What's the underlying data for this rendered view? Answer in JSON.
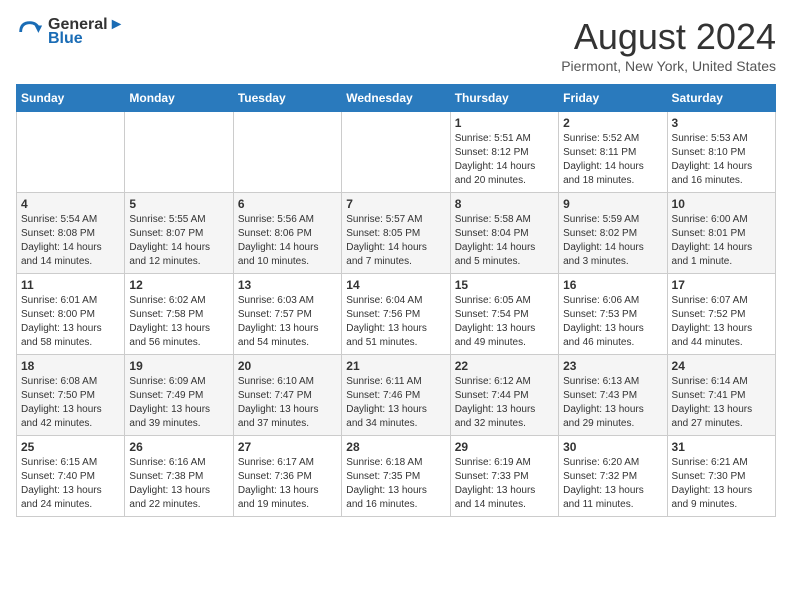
{
  "header": {
    "logo_line1": "General",
    "logo_line2": "Blue",
    "month": "August 2024",
    "location": "Piermont, New York, United States"
  },
  "weekdays": [
    "Sunday",
    "Monday",
    "Tuesday",
    "Wednesday",
    "Thursday",
    "Friday",
    "Saturday"
  ],
  "weeks": [
    [
      {
        "day": "",
        "info": ""
      },
      {
        "day": "",
        "info": ""
      },
      {
        "day": "",
        "info": ""
      },
      {
        "day": "",
        "info": ""
      },
      {
        "day": "1",
        "info": "Sunrise: 5:51 AM\nSunset: 8:12 PM\nDaylight: 14 hours\nand 20 minutes."
      },
      {
        "day": "2",
        "info": "Sunrise: 5:52 AM\nSunset: 8:11 PM\nDaylight: 14 hours\nand 18 minutes."
      },
      {
        "day": "3",
        "info": "Sunrise: 5:53 AM\nSunset: 8:10 PM\nDaylight: 14 hours\nand 16 minutes."
      }
    ],
    [
      {
        "day": "4",
        "info": "Sunrise: 5:54 AM\nSunset: 8:08 PM\nDaylight: 14 hours\nand 14 minutes."
      },
      {
        "day": "5",
        "info": "Sunrise: 5:55 AM\nSunset: 8:07 PM\nDaylight: 14 hours\nand 12 minutes."
      },
      {
        "day": "6",
        "info": "Sunrise: 5:56 AM\nSunset: 8:06 PM\nDaylight: 14 hours\nand 10 minutes."
      },
      {
        "day": "7",
        "info": "Sunrise: 5:57 AM\nSunset: 8:05 PM\nDaylight: 14 hours\nand 7 minutes."
      },
      {
        "day": "8",
        "info": "Sunrise: 5:58 AM\nSunset: 8:04 PM\nDaylight: 14 hours\nand 5 minutes."
      },
      {
        "day": "9",
        "info": "Sunrise: 5:59 AM\nSunset: 8:02 PM\nDaylight: 14 hours\nand 3 minutes."
      },
      {
        "day": "10",
        "info": "Sunrise: 6:00 AM\nSunset: 8:01 PM\nDaylight: 14 hours\nand 1 minute."
      }
    ],
    [
      {
        "day": "11",
        "info": "Sunrise: 6:01 AM\nSunset: 8:00 PM\nDaylight: 13 hours\nand 58 minutes."
      },
      {
        "day": "12",
        "info": "Sunrise: 6:02 AM\nSunset: 7:58 PM\nDaylight: 13 hours\nand 56 minutes."
      },
      {
        "day": "13",
        "info": "Sunrise: 6:03 AM\nSunset: 7:57 PM\nDaylight: 13 hours\nand 54 minutes."
      },
      {
        "day": "14",
        "info": "Sunrise: 6:04 AM\nSunset: 7:56 PM\nDaylight: 13 hours\nand 51 minutes."
      },
      {
        "day": "15",
        "info": "Sunrise: 6:05 AM\nSunset: 7:54 PM\nDaylight: 13 hours\nand 49 minutes."
      },
      {
        "day": "16",
        "info": "Sunrise: 6:06 AM\nSunset: 7:53 PM\nDaylight: 13 hours\nand 46 minutes."
      },
      {
        "day": "17",
        "info": "Sunrise: 6:07 AM\nSunset: 7:52 PM\nDaylight: 13 hours\nand 44 minutes."
      }
    ],
    [
      {
        "day": "18",
        "info": "Sunrise: 6:08 AM\nSunset: 7:50 PM\nDaylight: 13 hours\nand 42 minutes."
      },
      {
        "day": "19",
        "info": "Sunrise: 6:09 AM\nSunset: 7:49 PM\nDaylight: 13 hours\nand 39 minutes."
      },
      {
        "day": "20",
        "info": "Sunrise: 6:10 AM\nSunset: 7:47 PM\nDaylight: 13 hours\nand 37 minutes."
      },
      {
        "day": "21",
        "info": "Sunrise: 6:11 AM\nSunset: 7:46 PM\nDaylight: 13 hours\nand 34 minutes."
      },
      {
        "day": "22",
        "info": "Sunrise: 6:12 AM\nSunset: 7:44 PM\nDaylight: 13 hours\nand 32 minutes."
      },
      {
        "day": "23",
        "info": "Sunrise: 6:13 AM\nSunset: 7:43 PM\nDaylight: 13 hours\nand 29 minutes."
      },
      {
        "day": "24",
        "info": "Sunrise: 6:14 AM\nSunset: 7:41 PM\nDaylight: 13 hours\nand 27 minutes."
      }
    ],
    [
      {
        "day": "25",
        "info": "Sunrise: 6:15 AM\nSunset: 7:40 PM\nDaylight: 13 hours\nand 24 minutes."
      },
      {
        "day": "26",
        "info": "Sunrise: 6:16 AM\nSunset: 7:38 PM\nDaylight: 13 hours\nand 22 minutes."
      },
      {
        "day": "27",
        "info": "Sunrise: 6:17 AM\nSunset: 7:36 PM\nDaylight: 13 hours\nand 19 minutes."
      },
      {
        "day": "28",
        "info": "Sunrise: 6:18 AM\nSunset: 7:35 PM\nDaylight: 13 hours\nand 16 minutes."
      },
      {
        "day": "29",
        "info": "Sunrise: 6:19 AM\nSunset: 7:33 PM\nDaylight: 13 hours\nand 14 minutes."
      },
      {
        "day": "30",
        "info": "Sunrise: 6:20 AM\nSunset: 7:32 PM\nDaylight: 13 hours\nand 11 minutes."
      },
      {
        "day": "31",
        "info": "Sunrise: 6:21 AM\nSunset: 7:30 PM\nDaylight: 13 hours\nand 9 minutes."
      }
    ]
  ]
}
